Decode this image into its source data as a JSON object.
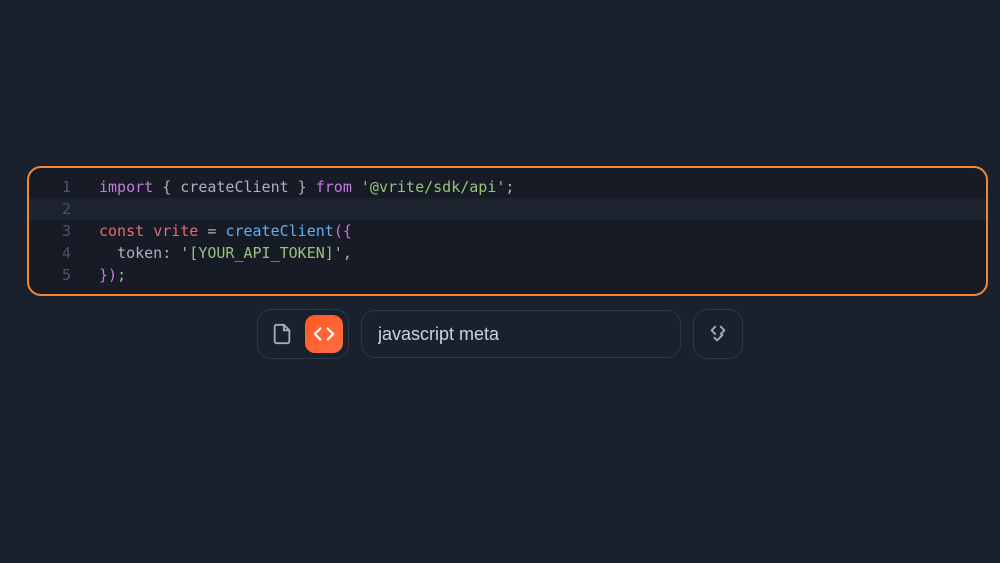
{
  "code": {
    "lines": [
      {
        "num": "1",
        "tokens": [
          {
            "t": "import",
            "c": "tok-import"
          },
          {
            "t": " ",
            "c": ""
          },
          {
            "t": "{ ",
            "c": "tok-brace"
          },
          {
            "t": "createClient",
            "c": "tok-identifier"
          },
          {
            "t": " }",
            "c": "tok-brace"
          },
          {
            "t": " ",
            "c": ""
          },
          {
            "t": "from",
            "c": "tok-from"
          },
          {
            "t": " ",
            "c": ""
          },
          {
            "t": "'@vrite/sdk/api'",
            "c": "tok-string"
          },
          {
            "t": ";",
            "c": "tok-punct"
          }
        ],
        "highlighted": false
      },
      {
        "num": "2",
        "tokens": [],
        "highlighted": true
      },
      {
        "num": "3",
        "tokens": [
          {
            "t": "const",
            "c": "tok-keyword"
          },
          {
            "t": " ",
            "c": ""
          },
          {
            "t": "vrite",
            "c": "tok-var"
          },
          {
            "t": " ",
            "c": ""
          },
          {
            "t": "=",
            "c": "tok-punct"
          },
          {
            "t": " ",
            "c": ""
          },
          {
            "t": "createClient",
            "c": "tok-func"
          },
          {
            "t": "({",
            "c": "tok-paren"
          }
        ],
        "highlighted": false
      },
      {
        "num": "4",
        "tokens": [
          {
            "t": "  ",
            "c": ""
          },
          {
            "t": "token",
            "c": "tok-property"
          },
          {
            "t": ": ",
            "c": "tok-punct"
          },
          {
            "t": "'[YOUR_API_TOKEN]'",
            "c": "tok-string"
          },
          {
            "t": ",",
            "c": "tok-punct"
          }
        ],
        "highlighted": false
      },
      {
        "num": "5",
        "tokens": [
          {
            "t": "})",
            "c": "tok-paren"
          },
          {
            "t": ";",
            "c": "tok-punct"
          }
        ],
        "highlighted": false
      }
    ]
  },
  "toolbar": {
    "input_value": "javascript meta"
  }
}
